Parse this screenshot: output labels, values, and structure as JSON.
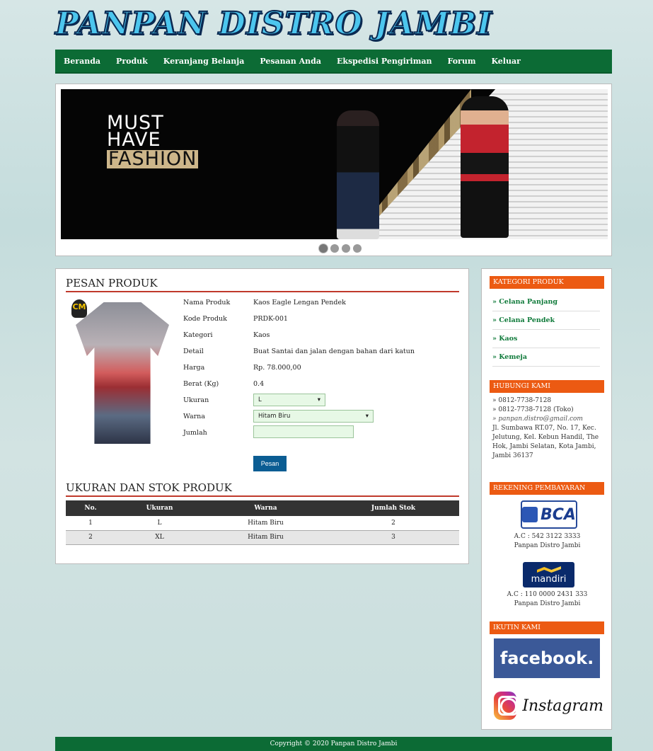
{
  "site": {
    "title": "PANPAN DISTRO JAMBI"
  },
  "nav": [
    "Beranda",
    "Produk",
    "Keranjang Belanja",
    "Pesanan Anda",
    "Ekspedisi Pengiriman",
    "Forum",
    "Keluar"
  ],
  "banner": {
    "line1": "MUST",
    "line2": "HAVE",
    "line3": "FASHION",
    "active_slide": 1,
    "slide_count": 4
  },
  "order": {
    "heading": "PESAN PRODUK",
    "fields": [
      {
        "label": "Nama Produk",
        "value": "Kaos Eagle Lengan Pendek"
      },
      {
        "label": "Kode Produk",
        "value": "PRDK-001"
      },
      {
        "label": "Kategori",
        "value": "Kaos"
      },
      {
        "label": "Detail",
        "value": "Buat Santai dan jalan dengan bahan dari katun"
      },
      {
        "label": "Harga",
        "value": "Rp. 78.000,00"
      },
      {
        "label": "Berat (Kg)",
        "value": "0.4"
      }
    ],
    "size": {
      "label": "Ukuran",
      "selected": "L"
    },
    "color": {
      "label": "Warna",
      "selected": "Hitam Biru"
    },
    "qty": {
      "label": "Jumlah",
      "value": ""
    },
    "button": "Pesan",
    "logo_text": "CM"
  },
  "stock": {
    "heading": "UKURAN DAN STOK PRODUK",
    "columns": [
      "No.",
      "Ukuran",
      "Warna",
      "Jumlah Stok"
    ],
    "rows": [
      [
        "1",
        "L",
        "Hitam Biru",
        "2"
      ],
      [
        "2",
        "XL",
        "Hitam Biru",
        "3"
      ]
    ]
  },
  "sidebar": {
    "categories_title": "KATEGORI PRODUK",
    "categories": [
      "» Celana Panjang",
      "» Celana Pendek",
      "» Kaos",
      "» Kemeja"
    ],
    "contact_title": "HUBUNGI KAMI",
    "phone1": "» 0812-7738-7128",
    "phone2": "» 0812-7738-7128 (Toko)",
    "email": "» panpan.distro@gmail.com",
    "address": "Jl. Sumbawa RT.07, No. 17, Kec. Jelutung, Kel. Kebun Handil, The Hok, Jambi Selatan, Kota Jambi, Jambi 36137",
    "payment_title": "REKENING PEMBAYARAN",
    "bca": {
      "logo": "BCA",
      "account": "A.C : 542 3122 3333",
      "name": "Panpan Distro Jambi"
    },
    "mandiri": {
      "logo": "mandiri",
      "account": "A.C : 110 0000 2431 333",
      "name": "Panpan Distro Jambi"
    },
    "follow_title": "IKUTIN KAMI",
    "facebook": "facebook.",
    "instagram": "Instagram"
  },
  "footer": "Copyright © 2020 Panpan Distro Jambi"
}
